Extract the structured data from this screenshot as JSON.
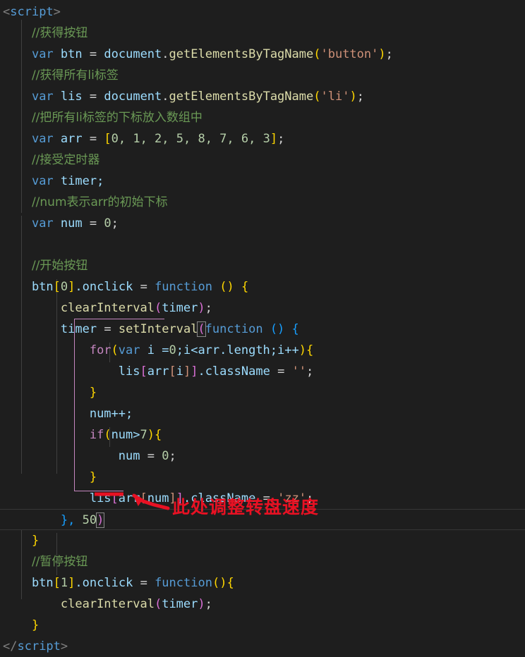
{
  "editor": {
    "theme_background": "#1e1e1e",
    "language": "javascript",
    "colors": {
      "comment": "#6a9955",
      "keyword": "#569cd6",
      "control": "#c586c0",
      "variable": "#9cdcfe",
      "function": "#dcdcaa",
      "string": "#ce9178",
      "number": "#b5cea8",
      "bracket_level1": "#ffd700",
      "bracket_level2": "#da70d6",
      "bracket_level3": "#179fff",
      "annotation": "#e81123"
    }
  },
  "code": {
    "line_01": "<script>",
    "line_02": "//获得按钮",
    "line_03_var": "var",
    "line_03_name": "btn",
    "line_03_obj": "document",
    "line_03_method": "getElementsByTagName",
    "line_03_arg": "'button'",
    "line_04": "//获得所有li标签",
    "line_05_var": "var",
    "line_05_name": "lis",
    "line_05_obj": "document",
    "line_05_method": "getElementsByTagName",
    "line_05_arg": "'li'",
    "line_06": "//把所有li标签的下标放入数组中",
    "line_07_var": "var",
    "line_07_name": "arr",
    "line_07_values": "0, 1, 2, 5, 8, 7, 6, 3",
    "line_08": "//接受定时器",
    "line_09_var": "var",
    "line_09_name": "timer;",
    "line_10": "//num表示arr的初始下标",
    "line_11_var": "var",
    "line_11_name": "num",
    "line_11_value": "0",
    "line_13": "//开始按钮",
    "line_14_target": "btn",
    "line_14_index": "0",
    "line_14_prop": ".onclick",
    "line_14_kw": "function",
    "line_15_fn": "clearInterval",
    "line_15_arg": "timer",
    "line_16_var": "timer",
    "line_16_fn": "setInterval",
    "line_16_kw": "function",
    "line_17_kw": "for",
    "line_17_var": "var",
    "line_17_init": "i =",
    "line_17_zero": "0",
    "line_17_cond": ";i<arr.length;i++",
    "line_18_obj": "lis",
    "line_18_idx": "arr",
    "line_18_i": "i",
    "line_18_prop": ".className",
    "line_18_val": "''",
    "line_20": "num++;",
    "line_21_kw": "if",
    "line_21_cond": "num>",
    "line_21_num": "7",
    "line_22_var": "num",
    "line_22_val": "0",
    "line_24_obj": "lis",
    "line_24_idx": "arr",
    "line_24_num": "num",
    "line_24_prop": ".className",
    "line_24_val": "'zz'",
    "line_25_close": "}, ",
    "line_25_delay": "50",
    "line_27": "//暂停按钮",
    "line_28_target": "btn",
    "line_28_index": "1",
    "line_28_prop": ".onclick",
    "line_28_kw": "function",
    "line_29_fn": "clearInterval",
    "line_29_arg": "timer",
    "line_31": "</script>"
  },
  "annotation": {
    "text": "此处调整转盘速度",
    "color": "#e81123",
    "underline_target": "50",
    "arrow_from": "text",
    "arrow_to": "delay-value"
  }
}
